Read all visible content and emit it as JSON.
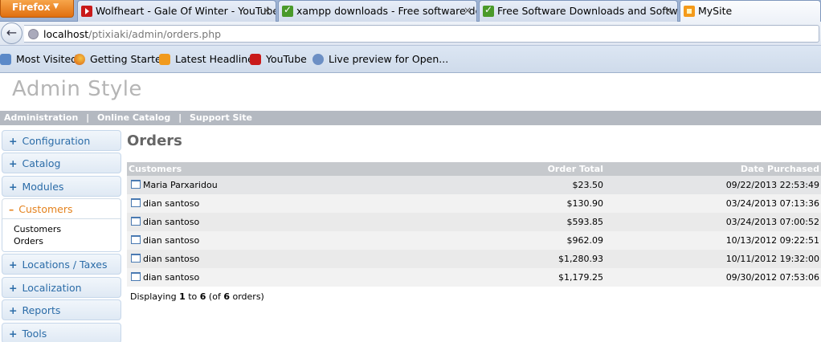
{
  "browser": {
    "menu_button": "Firefox",
    "tabs": [
      {
        "title": "Wolfheart - Gale Of Winter - YouTube",
        "icon": "youtube-icon"
      },
      {
        "title": "xampp downloads - Free software do...",
        "icon": "download-site-icon"
      },
      {
        "title": "Free Software Downloads and Softwa...",
        "icon": "download-site-icon"
      },
      {
        "title": "MySite",
        "icon": "site-icon"
      }
    ],
    "close_glyph": "×",
    "url_host": "localhost",
    "url_path": "/ptixiaki/admin/orders.php",
    "bookmarks": [
      "Most Visited",
      "Getting Started",
      "Latest Headlines",
      "YouTube",
      "Live preview for Open..."
    ]
  },
  "site": {
    "title": "Admin Style",
    "topnav": [
      "Administration",
      "Online Catalog",
      "Support Site"
    ],
    "topnav_separator": "|"
  },
  "sidebar": {
    "groups": [
      {
        "label": "Configuration",
        "sign": "+"
      },
      {
        "label": "Catalog",
        "sign": "+"
      },
      {
        "label": "Modules",
        "sign": "+"
      },
      {
        "label": "Customers",
        "sign": "–"
      },
      {
        "label": "Locations / Taxes",
        "sign": "+"
      },
      {
        "label": "Localization",
        "sign": "+"
      },
      {
        "label": "Reports",
        "sign": "+"
      },
      {
        "label": "Tools",
        "sign": "+"
      }
    ],
    "customers_links": [
      "Customers",
      "Orders"
    ]
  },
  "main": {
    "heading": "Orders",
    "table": {
      "headers": [
        "Customers",
        "Order Total",
        "Date Purchased"
      ],
      "rows": [
        {
          "customer": "Maria Parxaridou",
          "total": "$23.50",
          "date": "09/22/2013 22:53:49"
        },
        {
          "customer": "dian santoso",
          "total": "$130.90",
          "date": "03/24/2013 07:13:36"
        },
        {
          "customer": "dian santoso",
          "total": "$593.85",
          "date": "03/24/2013 07:00:52"
        },
        {
          "customer": "dian santoso",
          "total": "$962.09",
          "date": "10/13/2012 09:22:51"
        },
        {
          "customer": "dian santoso",
          "total": "$1,280.93",
          "date": "10/11/2012 19:32:00"
        },
        {
          "customer": "dian santoso",
          "total": "$1,179.25",
          "date": "09/30/2012 07:53:06"
        }
      ]
    },
    "paging": {
      "prefix": "Displaying",
      "from": "1",
      "to_word": "to",
      "to": "6",
      "of_open": "(of",
      "total": "6",
      "suffix": "orders)"
    }
  }
}
